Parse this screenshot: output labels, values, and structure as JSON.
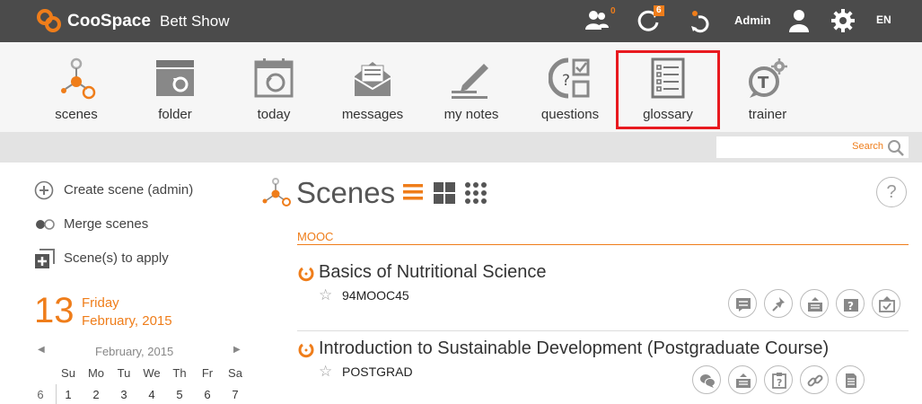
{
  "header": {
    "brand": "CooSpace",
    "course": "Bett Show",
    "user_badge": "0",
    "sync_badge": "6",
    "user_label": "Admin",
    "language": "EN",
    "colors": {
      "bar": "#4b4b4b",
      "accent": "#ef7d1a"
    }
  },
  "modules": [
    {
      "label": "scenes",
      "icon": "scenes-icon"
    },
    {
      "label": "folder",
      "icon": "folder-icon"
    },
    {
      "label": "today",
      "icon": "calendar-today-icon"
    },
    {
      "label": "messages",
      "icon": "envelope-icon"
    },
    {
      "label": "my notes",
      "icon": "pencil-notes-icon"
    },
    {
      "label": "questions",
      "icon": "questions-icon"
    },
    {
      "label": "glossary",
      "icon": "glossary-list-icon",
      "highlighted": true
    },
    {
      "label": "trainer",
      "icon": "trainer-icon"
    }
  ],
  "search": {
    "label": "Search"
  },
  "sidebar": {
    "actions": [
      {
        "label": "Create scene (admin)",
        "icon": "add-circle-icon"
      },
      {
        "label": "Merge scenes",
        "icon": "merge-toggle-icon"
      },
      {
        "label": "Scene(s) to apply",
        "icon": "apply-plus-icon"
      }
    ],
    "date": {
      "day": "13",
      "weekday": "Friday",
      "month_year": "February, 2015"
    },
    "calendar": {
      "month": "February, 2015",
      "prev": "◀",
      "next": "▶",
      "weekdays": [
        "Su",
        "Mo",
        "Tu",
        "We",
        "Th",
        "Fr",
        "Sa"
      ],
      "rows": [
        {
          "week": "6",
          "days": [
            "1",
            "2",
            "3",
            "4",
            "5",
            "6",
            "7"
          ]
        }
      ]
    }
  },
  "main": {
    "title": "Scenes",
    "help": "?",
    "group": "MOOC",
    "scenes": [
      {
        "title": "Basics of Nutritional Science",
        "code": "94MOOC45",
        "actions": [
          "message-icon",
          "pin-icon",
          "tray-icon",
          "question-tray-icon",
          "inbox-check-icon"
        ]
      },
      {
        "title": "Introduction to Sustainable Development (Postgraduate Course)",
        "code": "POSTGRAD",
        "actions": [
          "chat-icon",
          "tray-icon",
          "clipboard-question-icon",
          "link-icon",
          "document-icon"
        ]
      }
    ]
  }
}
